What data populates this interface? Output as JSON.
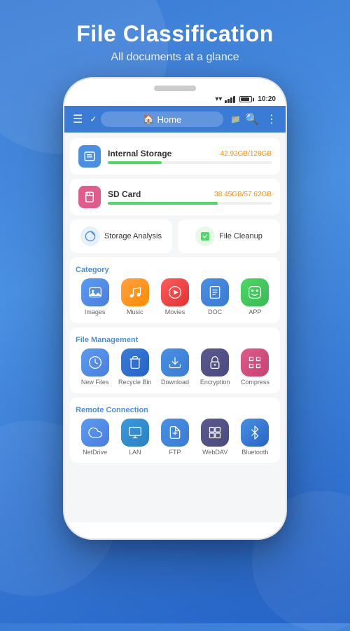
{
  "header": {
    "title": "File Classification",
    "subtitle": "All documents at a glance"
  },
  "statusBar": {
    "time": "10:20"
  },
  "appBar": {
    "homeLabel": "Home"
  },
  "storage": [
    {
      "name": "Internal Storage",
      "used": "42.92GB",
      "total": "128GB",
      "fillPercent": 33,
      "type": "internal"
    },
    {
      "name": "SD Card",
      "used": "38.45GB",
      "total": "57.62GB",
      "fillPercent": 67,
      "type": "sdcard"
    }
  ],
  "quickActions": [
    {
      "label": "Storage Analysis",
      "type": "storage-analysis"
    },
    {
      "label": "File Cleanup",
      "type": "file-cleanup"
    }
  ],
  "category": {
    "label": "Category",
    "items": [
      {
        "label": "Images",
        "type": "images",
        "icon": "🏔"
      },
      {
        "label": "Music",
        "type": "music",
        "icon": "🎵"
      },
      {
        "label": "Movies",
        "type": "movies",
        "icon": "🎬"
      },
      {
        "label": "DOC",
        "type": "doc",
        "icon": "≡"
      },
      {
        "label": "APP",
        "type": "app",
        "icon": "🤖"
      }
    ]
  },
  "fileManagement": {
    "label": "File Management",
    "items": [
      {
        "label": "New Files",
        "type": "newfiles",
        "icon": "🕐"
      },
      {
        "label": "Recycle Bin",
        "type": "recycle",
        "icon": "🗑"
      },
      {
        "label": "Download",
        "type": "download",
        "icon": "⬇"
      },
      {
        "label": "Encryption",
        "type": "encryption",
        "icon": "🔒"
      },
      {
        "label": "Compress",
        "type": "compress",
        "icon": "📦"
      }
    ]
  },
  "remoteConnection": {
    "label": "Remote Connection",
    "items": [
      {
        "label": "NetDrive",
        "type": "netdrive",
        "icon": "☁"
      },
      {
        "label": "LAN",
        "type": "lan",
        "icon": "🖥"
      },
      {
        "label": "FTP",
        "type": "ftp",
        "icon": "📁"
      },
      {
        "label": "WebDAV",
        "type": "webdav",
        "icon": "🔲"
      },
      {
        "label": "Bluetooth",
        "type": "bluetooth",
        "icon": "✱"
      }
    ]
  }
}
